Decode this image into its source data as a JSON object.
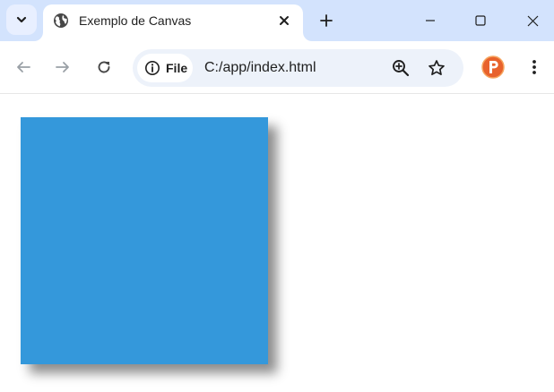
{
  "tab": {
    "title": "Exemplo de Canvas"
  },
  "omnibox": {
    "chip_label": "File",
    "url": "C:/app/index.html"
  },
  "colors": {
    "tabbar_bg": "#d3e3fd",
    "omnibox_bg": "#edf2fa",
    "canvas_square": "#3498db"
  },
  "icons": {
    "tab_search": "chevron-down-icon",
    "favicon": "globe-icon",
    "tab_close": "close-icon",
    "new_tab": "plus-icon",
    "back": "arrow-left-icon",
    "forward": "arrow-right-icon",
    "reload": "reload-icon",
    "site_info": "info-icon",
    "zoom": "zoom-in-icon",
    "bookmark": "star-icon",
    "extension": "extension-p-icon",
    "menu": "more-vertical-icon"
  }
}
